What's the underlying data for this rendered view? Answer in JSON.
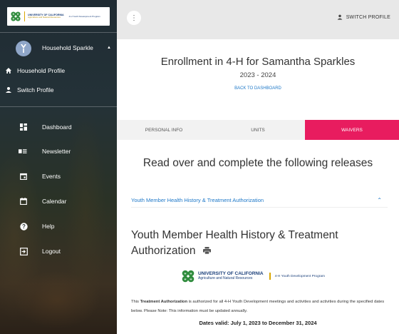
{
  "sidebar": {
    "logo": {
      "university": "UNIVERSITY OF CALIFORNIA",
      "division": "Agriculture and Natural Resources",
      "program": "4-H Youth Development Program"
    },
    "account_name": "Household Sparkle",
    "household_profile": "Household Profile",
    "switch_profile": "Switch Profile",
    "nav": [
      {
        "label": "Dashboard",
        "icon": "dashboard-icon"
      },
      {
        "label": "Newsletter",
        "icon": "newsletter-icon"
      },
      {
        "label": "Events",
        "icon": "events-icon"
      },
      {
        "label": "Calendar",
        "icon": "calendar-icon"
      },
      {
        "label": "Help",
        "icon": "help-icon"
      },
      {
        "label": "Logout",
        "icon": "logout-icon"
      }
    ]
  },
  "topbar": {
    "menu_glyph": "⋮",
    "switch_profile": "SWITCH PROFILE"
  },
  "main": {
    "title": "Enrollment in 4-H for Samantha Sparkles",
    "year": "2023 - 2024",
    "back_link": "BACK TO DASHBOARD",
    "tabs": [
      "PERSONAL INFO",
      "UNITS",
      "WAIVERS"
    ],
    "active_tab": "WAIVERS",
    "section_heading": "Read over and complete the following releases",
    "accordion_label": "Youth Member Health History & Treatment Authorization",
    "waiver_title": "Youth Member Health History & Treatment Authorization",
    "uc_logo": {
      "line1": "UNIVERSITY OF CALIFORNIA",
      "line2": "Agriculture and Natural Resources",
      "line3": "4-H Youth Development Program"
    },
    "body_prefix": "This ",
    "body_bold": "Treatment Authorization",
    "body_rest": " is authorized for all 4-H Youth Development meetings and activities and activities during the specified dates below. Please Note: This information must be updated annually.",
    "dates": "Dates valid: July 1, 2023 to December 31, 2024"
  },
  "colors": {
    "accent": "#e81c5f",
    "link": "#1e78c8",
    "clover_green": "#2e8b3c"
  }
}
